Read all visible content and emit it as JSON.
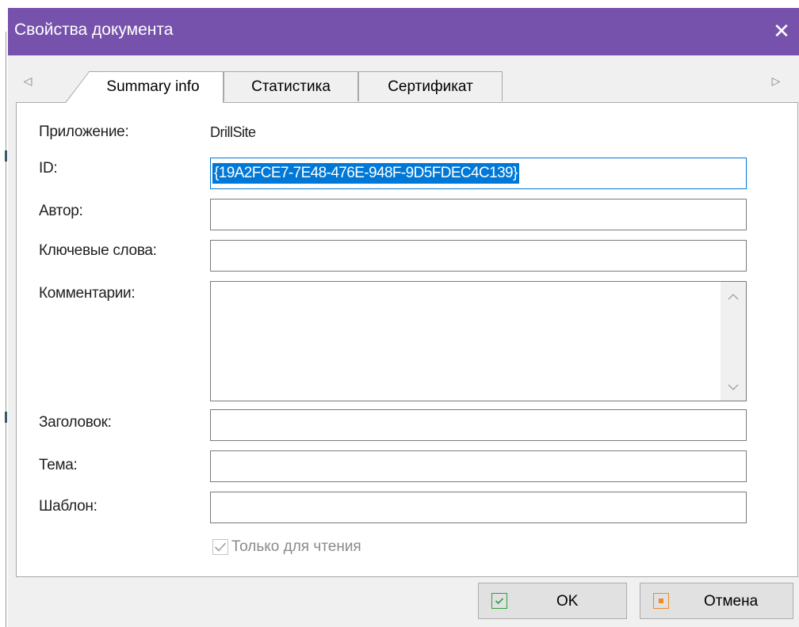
{
  "window": {
    "title": "Свойства документа",
    "close_glyph": "✕"
  },
  "tabs": {
    "scroll_left": "◁",
    "scroll_right": "▷",
    "items": [
      {
        "label": "Summary info",
        "active": true
      },
      {
        "label": "Статистика",
        "active": false
      },
      {
        "label": "Сертификат",
        "active": false
      }
    ]
  },
  "form": {
    "application": {
      "label": "Приложение:",
      "value": "DrillSite"
    },
    "id": {
      "label": "ID:",
      "value": "{19A2FCE7-7E48-476E-948F-9D5FDEC4C139}"
    },
    "author": {
      "label": "Автор:",
      "value": ""
    },
    "keywords": {
      "label": "Ключевые слова:",
      "value": ""
    },
    "comments": {
      "label": "Комментарии:",
      "value": ""
    },
    "title": {
      "label": "Заголовок:",
      "value": ""
    },
    "subject": {
      "label": "Тема:",
      "value": ""
    },
    "template": {
      "label": "Шаблон:",
      "value": ""
    },
    "readonly": {
      "label": "Только для чтения",
      "checked": true,
      "enabled": false
    }
  },
  "buttons": {
    "ok": {
      "label": "OK",
      "icon": "check-icon",
      "color": "#2e9e3e"
    },
    "cancel": {
      "label": "Отмена",
      "icon": "cancel-icon",
      "color": "#f08a24"
    }
  },
  "colors": {
    "titlebar": "#7752ac",
    "selection": "#0078d7"
  }
}
